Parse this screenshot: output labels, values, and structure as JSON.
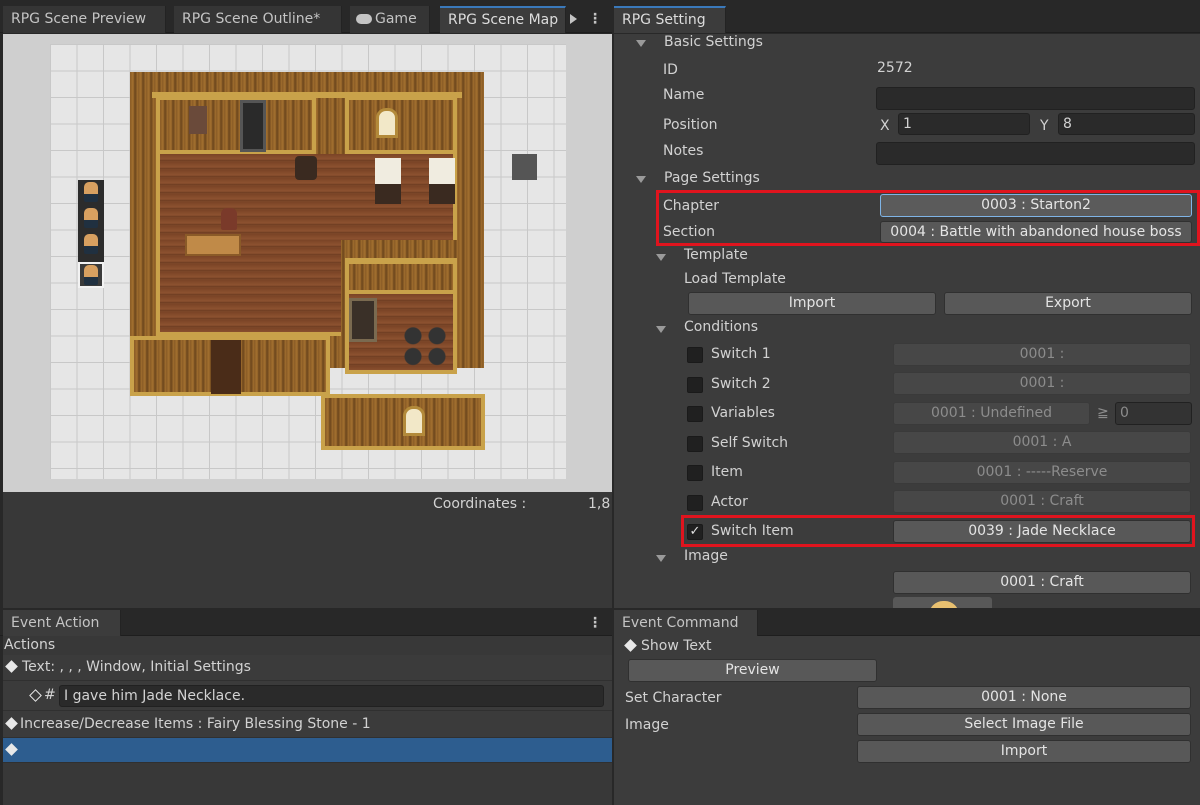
{
  "left_tabs": [
    "RPG Scene Preview",
    "RPG Scene Outline*",
    "Game",
    "RPG Scene Map"
  ],
  "right_tabs": [
    "RPG Setting"
  ],
  "map": {
    "coordinates_label": "Coordinates :",
    "coordinates_value": "1,8"
  },
  "setting": {
    "basic_header": "Basic Settings",
    "id_label": "ID",
    "id_value": "2572",
    "name_label": "Name",
    "name_value": "",
    "position_label": "Position",
    "x_label": "X",
    "x_value": "1",
    "y_label": "Y",
    "y_value": "8",
    "notes_label": "Notes",
    "notes_value": "",
    "page_header": "Page Settings",
    "chapter_label": "Chapter",
    "chapter_value": "0003 : Starton2",
    "section_label": "Section",
    "section_value": "0004 : Battle with abandoned house boss",
    "template_header": "Template",
    "load_template_label": "Load Template",
    "import_label": "Import",
    "export_label": "Export",
    "conditions_header": "Conditions",
    "conditions": [
      {
        "label": "Switch 1",
        "value": "0001 :",
        "checked": false
      },
      {
        "label": "Switch 2",
        "value": "0001 :",
        "checked": false
      },
      {
        "label": "Variables",
        "value": "0001 : Undefined",
        "checked": false
      },
      {
        "label": "Self Switch",
        "value": "0001 : A",
        "checked": false
      },
      {
        "label": "Item",
        "value": "0001 : -----Reserve",
        "checked": false
      },
      {
        "label": "Actor",
        "value": "0001 : Craft",
        "checked": false
      },
      {
        "label": "Switch Item",
        "value": "0039 : Jade Necklace",
        "checked": true
      }
    ],
    "variables_op": "≧",
    "variables_num": "0",
    "checkmark": "✓",
    "image_header": "Image",
    "image_value": "0001 : Craft"
  },
  "event_action": {
    "tab": "Event Action",
    "actions_label": "Actions",
    "rows": [
      "Text: , , , Window, Initial Settings",
      "I gave him Jade Necklace.",
      "Increase/Decrease Items : Fairy Blessing Stone - 1",
      ""
    ],
    "sub_prefix": "#"
  },
  "event_command": {
    "tab": "Event Command",
    "show_text_label": "Show Text",
    "preview_label": "Preview",
    "set_character_label": "Set Character",
    "set_character_value": "0001 : None",
    "image_label": "Image",
    "select_image_label": "Select Image File",
    "import_label": "Import"
  },
  "colors": {
    "accent_tab": "#3a79bb",
    "highlight_box": "#e0141e",
    "selected_row": "#2d5d8f"
  }
}
